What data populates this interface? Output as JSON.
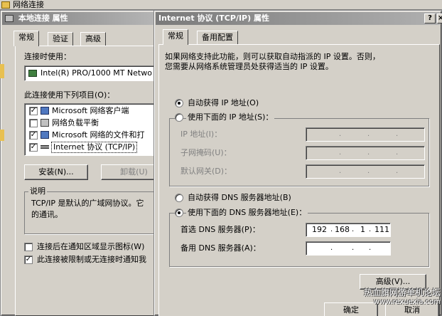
{
  "taskbar": {
    "title": "网络连接"
  },
  "left_dialog": {
    "title": "本地连接 属性",
    "tabs": [
      "常规",
      "验证",
      "高级"
    ],
    "connect_using_label": "连接时使用：",
    "adapter_name": "Intel(R) PRO/1000 MT Netwo",
    "items_label": "此连接使用下列项目(O)：",
    "items": [
      {
        "label": "Microsoft 网络客户端",
        "checked": true,
        "icon": "network-client-icon"
      },
      {
        "label": "网络负载平衡",
        "checked": false,
        "icon": "network-service-icon"
      },
      {
        "label": "Microsoft 网络的文件和打",
        "checked": true,
        "icon": "file-share-icon"
      },
      {
        "label": "Internet 协议 (TCP/IP)",
        "checked": true,
        "icon": "protocol-icon"
      }
    ],
    "install_button": "安装(N)...",
    "uninstall_button": "卸载(U)",
    "description_group": "说明",
    "description_line1": "TCP/IP 是默认的广域网协议。它",
    "description_line2": "的通讯。",
    "show_icon_label": "连接后在通知区域显示图标(W)",
    "show_icon_checked": false,
    "notify_label": "此连接被限制或无连接时通知我",
    "notify_checked": true
  },
  "right_dialog": {
    "title": "Internet 协议 (TCP/IP) 属性",
    "help_btn": "?",
    "close_btn": "×",
    "tabs": [
      "常规",
      "备用配置"
    ],
    "intro_line1": "如果网络支持此功能，则可以获取自动指派的 IP 设置。否则，",
    "intro_line2": "您需要从网络系统管理员处获得适当的 IP 设置。",
    "auto_ip_label": "自动获得 IP 地址(O)",
    "auto_ip_selected": true,
    "manual_ip_label": "使用下面的 IP 地址(S)：",
    "ip_label": "IP 地址(I)：",
    "subnet_label": "子网掩码(U)：",
    "gateway_label": "默认网关(D)：",
    "auto_dns_label": "自动获得 DNS 服务器地址(B)",
    "manual_dns_label": "使用下面的 DNS 服务器地址(E)：",
    "manual_dns_selected": true,
    "preferred_dns_label": "首选 DNS 服务器(P)：",
    "preferred_dns_octets": [
      "192",
      "168",
      "1",
      "111"
    ],
    "alternate_dns_label": "备用 DNS 服务器(A)：",
    "advanced_button": "高级(V)...",
    "ok_button": "确定",
    "cancel_button": "取消"
  },
  "watermark": {
    "line1": "热血旗网游单机论坛",
    "line2": "www.rexuexia.com"
  },
  "colors": {
    "face": "#d4d0c8",
    "active_title": "#0a246a",
    "inactive_title": "#808080",
    "highlight": "#0a246a"
  }
}
